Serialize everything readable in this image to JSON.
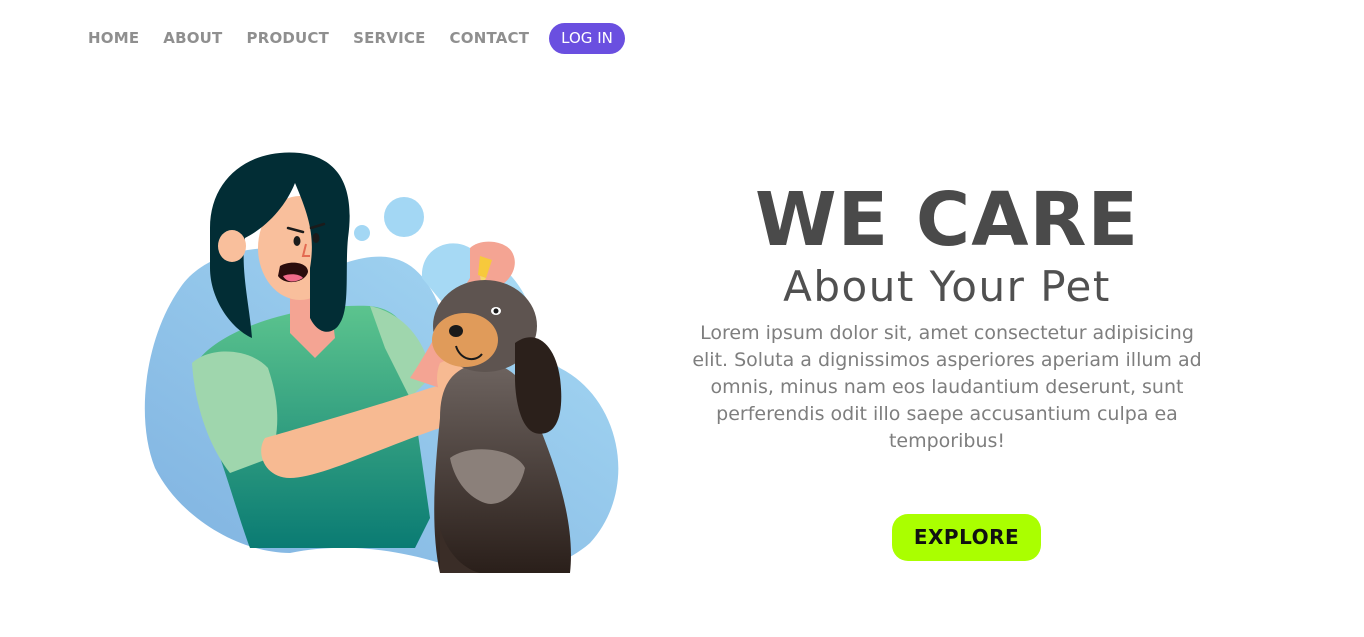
{
  "nav": {
    "items": [
      {
        "label": "HOME"
      },
      {
        "label": "ABOUT"
      },
      {
        "label": "PRODUCT"
      },
      {
        "label": "SERVICE"
      },
      {
        "label": "CONTACT"
      }
    ],
    "login_label": "LOG IN"
  },
  "hero": {
    "title": "WE CARE",
    "subtitle": "About Your Pet",
    "body": "Lorem ipsum dolor sit, amet consectetur adipisicing elit. Soluta a dignissimos asperiores aperiam illum ad omnis, minus nam eos laudantium deserunt, sunt perferendis odit illo saepe accusantium culpa ea temporibus!",
    "cta_label": "EXPLORE"
  },
  "colors": {
    "login_button": "#6a4fe0",
    "cta_button": "#aaff00",
    "heading_text": "#4a4a4a",
    "body_text": "#7e7e7e",
    "nav_text": "#8f8f8f",
    "blob_blue": "#8ec9ee"
  },
  "illustration": {
    "icon": "woman-giving-dog-eye-drops-illustration"
  }
}
